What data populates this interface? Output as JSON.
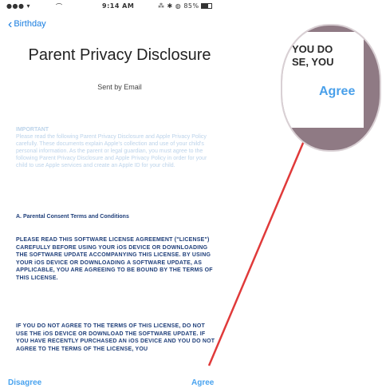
{
  "status_bar": {
    "signal": "●●● ▾",
    "wifi": "⌒",
    "time": "9:14 AM",
    "status": "⁂ ✱ ◍ 85%"
  },
  "nav": {
    "back_label": "Birthday"
  },
  "title": "Parent Privacy Disclosure",
  "sent_by": "Sent by Email",
  "important": {
    "heading": "IMPORTANT",
    "body": "Please read the following Parent Privacy Disclosure and Apple Privacy Policy carefully. These documents explain Apple's collection and use of your child's personal information. As the parent or legal guardian, you must agree to the following Parent Privacy Disclosure and Apple Privacy Policy in order for your child to use Apple services and create an Apple ID for your child."
  },
  "section_a": "A. Parental Consent Terms and Conditions",
  "legal_1": "PLEASE READ THIS SOFTWARE LICENSE AGREEMENT (\"LICENSE\") CAREFULLY BEFORE USING YOUR iOS DEVICE OR DOWNLOADING THE SOFTWARE UPDATE ACCOMPANYING THIS LICENSE. BY USING YOUR iOS DEVICE OR DOWNLOADING A SOFTWARE UPDATE, AS APPLICABLE, YOU ARE AGREEING TO BE BOUND BY THE TERMS OF THIS LICENSE.",
  "legal_2": "IF YOU DO NOT AGREE TO THE TERMS OF THIS LICENSE, DO NOT USE THE iOS DEVICE OR DOWNLOAD THE SOFTWARE UPDATE. IF YOU HAVE RECENTLY PURCHASED AN iOS DEVICE AND YOU DO NOT AGREE TO THE TERMS OF THE LICENSE, YOU",
  "toolbar": {
    "disagree": "Disagree",
    "agree": "Agree"
  },
  "magnifier": {
    "line1": "YOU DO",
    "line2": "SE, YOU",
    "agree": "Agree"
  },
  "colors": {
    "accent": "#1a7ee0",
    "arrow": "#e03a3a"
  }
}
